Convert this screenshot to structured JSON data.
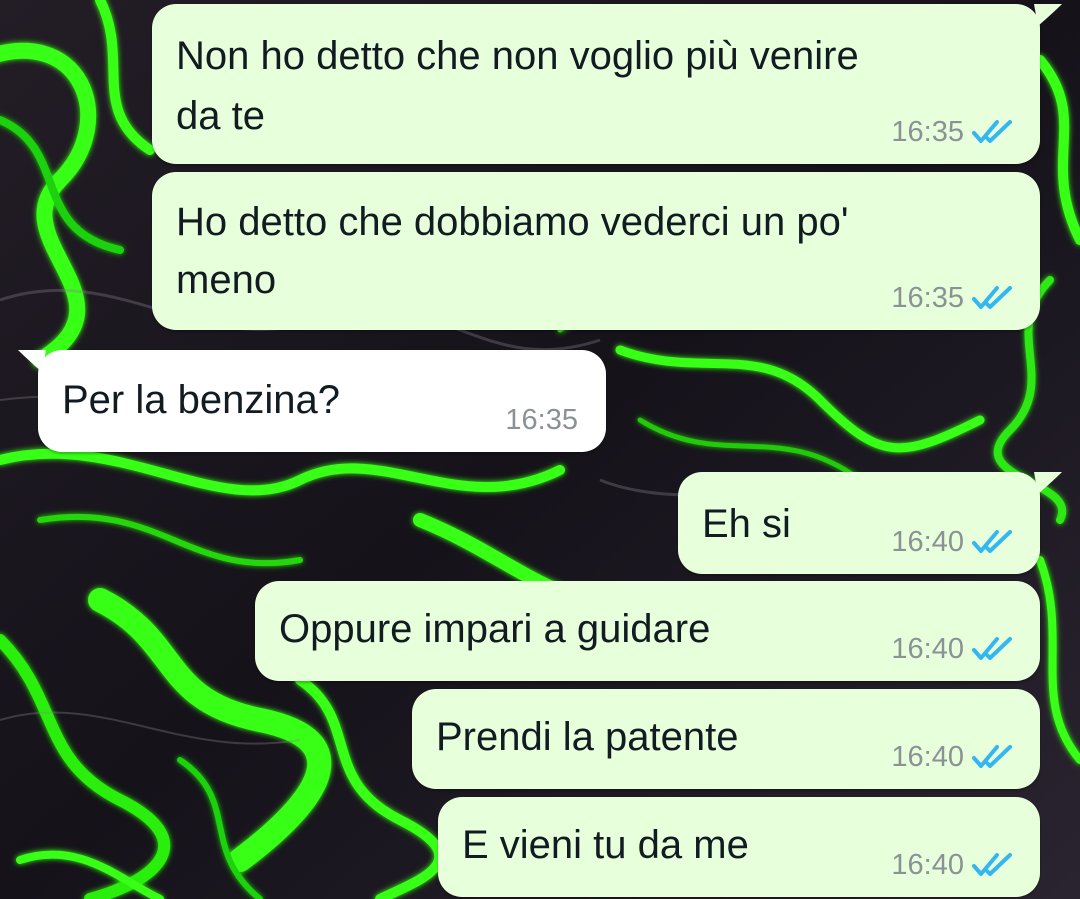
{
  "colors": {
    "outgoing_bubble": "#e7ffdb",
    "incoming_bubble": "#ffffff",
    "read_ticks": "#34b7f1",
    "wallpaper_dark": "#1a1620",
    "wallpaper_green": "#39ff14"
  },
  "icons": {
    "read_receipt": "double-check-icon"
  },
  "messages": [
    {
      "direction": "out",
      "lines": [
        "Non ho detto che non voglio più venire",
        "da te"
      ],
      "time": "16:35",
      "status": "read"
    },
    {
      "direction": "out",
      "lines": [
        "Ho detto che dobbiamo vederci un po'",
        "meno"
      ],
      "time": "16:35",
      "status": "read"
    },
    {
      "direction": "in",
      "lines": [
        "Per la benzina?"
      ],
      "time": "16:35"
    },
    {
      "direction": "out",
      "lines": [
        "Eh si"
      ],
      "time": "16:40",
      "status": "read"
    },
    {
      "direction": "out",
      "lines": [
        "Oppure impari a guidare"
      ],
      "time": "16:40",
      "status": "read"
    },
    {
      "direction": "out",
      "lines": [
        "Prendi la patente"
      ],
      "time": "16:40",
      "status": "read"
    },
    {
      "direction": "out",
      "lines": [
        "E vieni tu da me"
      ],
      "time": "16:40",
      "status": "read"
    }
  ]
}
